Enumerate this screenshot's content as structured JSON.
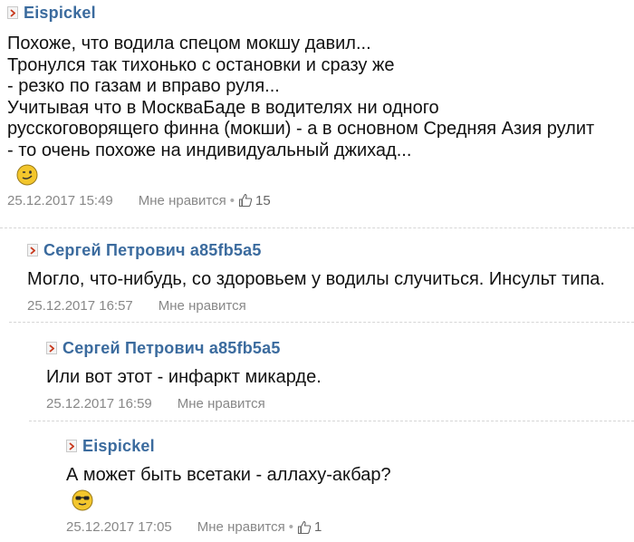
{
  "comments": [
    {
      "author": "Eispickel",
      "lines": [
        "Похоже, что водила спецом мокшу давил...",
        "Тронулся так тихонько с остановки и сразу же",
        "- резко по газам и вправо руля...",
        "Учитывая что в МоскваБаде в водителях ни одного",
        "русскоговорящего финна (мокши) - а в основном Средняя Азия рулит",
        "- то очень похоже на индивидуальный джихад..."
      ],
      "emoji": "wink-smiley-icon",
      "date": "25.12.2017 15:49",
      "like_label": "Мне нравится",
      "separator": "•",
      "likes": "15"
    },
    {
      "author": "Сергей Петрович a85fb5a5",
      "lines": [
        "Могло, что-нибудь, со здоровьем у водилы случиться. Инсульт типа."
      ],
      "date": "25.12.2017 16:57",
      "like_label": "Мне нравится"
    },
    {
      "author": "Сергей Петрович a85fb5a5",
      "lines": [
        "Или вот этот - инфаркт микарде."
      ],
      "date": "25.12.2017 16:59",
      "like_label": "Мне нравится"
    },
    {
      "author": "Eispickel",
      "lines": [
        "А может быть всетаки - аллаху-акбар?"
      ],
      "emoji": "sunglasses-smiley-icon",
      "date": "25.12.2017 17:05",
      "like_label": "Мне нравится",
      "separator": "•",
      "likes": "1"
    }
  ],
  "colors": {
    "author": "#3b6b9e",
    "arrow": "#c8391d",
    "meta": "#888888",
    "smiley": "#f3c62c"
  }
}
